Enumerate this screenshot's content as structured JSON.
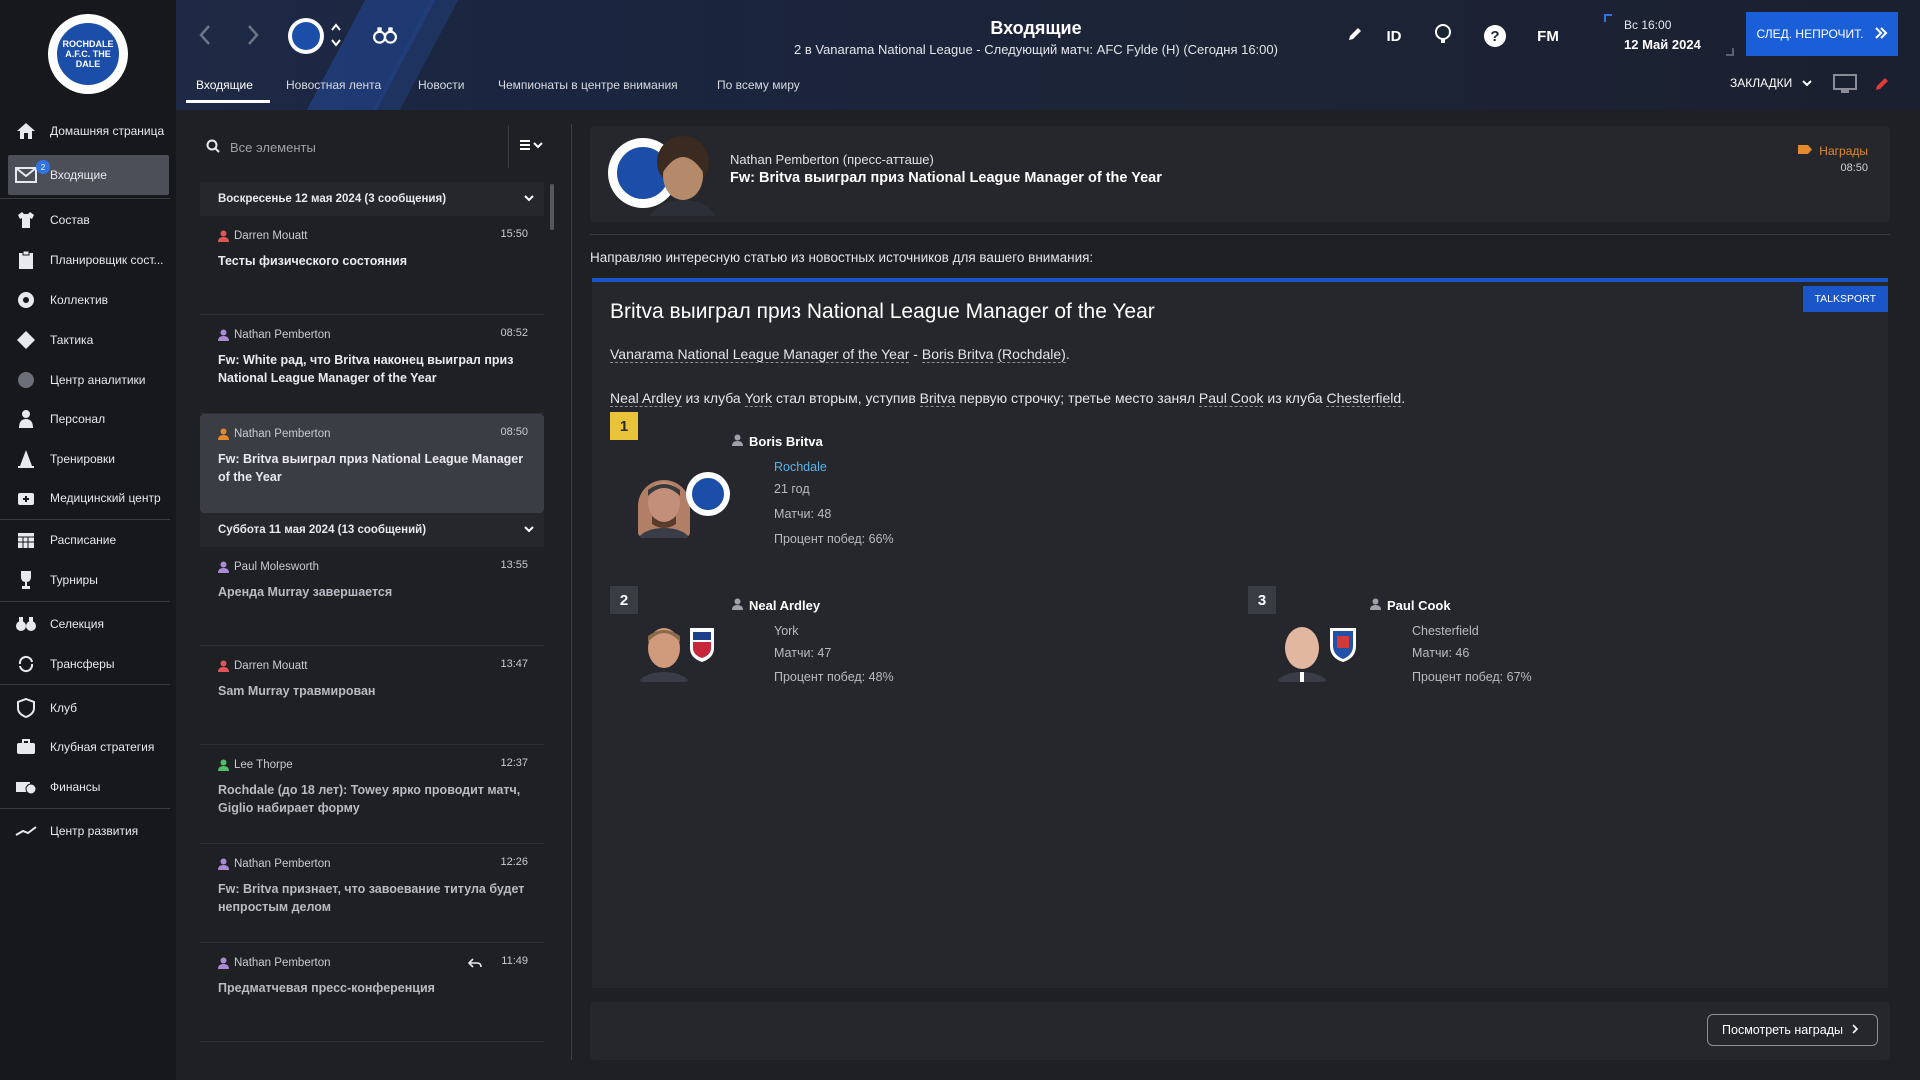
{
  "sidebar": {
    "club_crest_text": "ROCHDALE A.F.C. THE DALE",
    "badge_count": "2",
    "items": [
      {
        "label": "Домашняя страница",
        "icon": "home-icon"
      },
      {
        "label": "Входящие",
        "icon": "inbox-icon"
      },
      {
        "label": "Состав",
        "icon": "shirt-icon"
      },
      {
        "label": "Планировщик сост...",
        "icon": "clipboard-icon"
      },
      {
        "label": "Коллектив",
        "icon": "dynamics-icon"
      },
      {
        "label": "Тактика",
        "icon": "tactics-icon"
      },
      {
        "label": "Центр аналитики",
        "icon": "analytics-icon"
      },
      {
        "label": "Персонал",
        "icon": "staff-icon"
      },
      {
        "label": "Тренировки",
        "icon": "training-cone-icon"
      },
      {
        "label": "Медицинский центр",
        "icon": "medical-icon"
      },
      {
        "label": "Расписание",
        "icon": "calendar-icon"
      },
      {
        "label": "Турниры",
        "icon": "trophy-icon"
      },
      {
        "label": "Селекция",
        "icon": "binoculars-icon"
      },
      {
        "label": "Трансферы",
        "icon": "transfers-icon"
      },
      {
        "label": "Клуб",
        "icon": "club-shield-icon"
      },
      {
        "label": "Клубная стратегия",
        "icon": "strategy-icon"
      },
      {
        "label": "Финансы",
        "icon": "finances-icon"
      },
      {
        "label": "Центр развития",
        "icon": "development-icon"
      }
    ]
  },
  "header": {
    "title": "Входящие",
    "subtitle": "2 в Vanarama National League - Следующий матч: AFC Fylde (H) (Сегодня 16:00)",
    "tabs": [
      "Входящие",
      "Новостная лента",
      "Новости",
      "Чемпионаты в центре внимания",
      "По всему миру"
    ],
    "id_label": "ID",
    "fm_label": "FM",
    "date_line1": "Вс 16:00",
    "date_line2": "12 Май 2024",
    "next_button": "СЛЕД. НЕПРОЧИТ.",
    "bookmarks_label": "ЗАКЛАДКИ"
  },
  "list": {
    "search_placeholder": "Все элементы",
    "groups": [
      {
        "title": "Воскресенье 12 мая 2024 (3 сообщения)",
        "messages": [
          {
            "sender": "Darren Mouatt",
            "time": "15:50",
            "subject": "Тесты физического состояния",
            "person_color": "#e05555",
            "read": false
          },
          {
            "sender": "Nathan Pemberton",
            "time": "08:52",
            "subject": "Fw: White рад, что Britva наконец выиграл приз National League Manager of the Year",
            "person_color": "#a98bd6",
            "read": false
          },
          {
            "sender": "Nathan Pemberton",
            "time": "08:50",
            "subject": "Fw: Britva выиграл приз National League Manager of the Year",
            "person_color": "#e28a2c",
            "read": false
          }
        ]
      },
      {
        "title": "Суббота 11 мая 2024 (13 сообщений)",
        "messages": [
          {
            "sender": "Paul Molesworth",
            "time": "13:55",
            "subject": "Аренда Murray завершается",
            "person_color": "#a98bd6",
            "read": true
          },
          {
            "sender": "Darren Mouatt",
            "time": "13:47",
            "subject": "Sam Murray травмирован",
            "person_color": "#e05555",
            "read": true
          },
          {
            "sender": "Lee Thorpe",
            "time": "12:37",
            "subject": "Rochdale (до 18 лет): Towey ярко проводит матч, Giglio набирает форму",
            "person_color": "#4fbf6a",
            "read": true
          },
          {
            "sender": "Nathan Pemberton",
            "time": "12:26",
            "subject": "Fw: Britva признает, что завоевание титула будет непростым делом",
            "person_color": "#a98bd6",
            "read": true
          },
          {
            "sender": "Nathan Pemberton",
            "time": "11:49",
            "subject": "Предматчевая пресс-конференция",
            "person_color": "#a98bd6",
            "read": true
          }
        ]
      }
    ]
  },
  "message": {
    "sender": "Nathan Pemberton  (пресс-атташе)",
    "subject": "Fw: Britva выиграл приз National League Manager of the Year",
    "category": "Награды",
    "time": "08:50",
    "intro": "Направляю интересную статью из новостных источников для вашего внимания:",
    "view_awards_button": "Посмотреть награды"
  },
  "article": {
    "source": "TALKSPORT",
    "title": "Britva выиграл приз National League Manager of the Year",
    "line1": {
      "award": "Vanarama National League Manager of the Year",
      "sep": " - ",
      "winner": "Boris Britva",
      "club": "(Rochdale)",
      "end": "."
    },
    "line2": {
      "p1": "Neal Ardley",
      "t1": " из клуба ",
      "c1": "York",
      "t2": " стал вторым, уступив ",
      "p2": "Britva",
      "t3": " первую строчку; третье место занял ",
      "p3": "Paul Cook",
      "t4": " из клуба ",
      "c3": "Chesterfield",
      "end": "."
    },
    "nominees": [
      {
        "rank": "1",
        "name": "Boris Britva",
        "club": "Rochdale",
        "age": "21 год",
        "matches": "Матчи: 48",
        "win_pct": "Процент побед: 66%"
      },
      {
        "rank": "2",
        "name": "Neal Ardley",
        "club": "York",
        "matches": "Матчи: 47",
        "win_pct": "Процент побед: 48%"
      },
      {
        "rank": "3",
        "name": "Paul Cook",
        "club": "Chesterfield",
        "matches": "Матчи: 46",
        "win_pct": "Процент побед: 67%"
      }
    ]
  },
  "colors": {
    "accent": "#1b5fd8",
    "gold": "#e9c43a",
    "award_orange": "#e28a2c",
    "link_blue": "#58b3e8"
  }
}
